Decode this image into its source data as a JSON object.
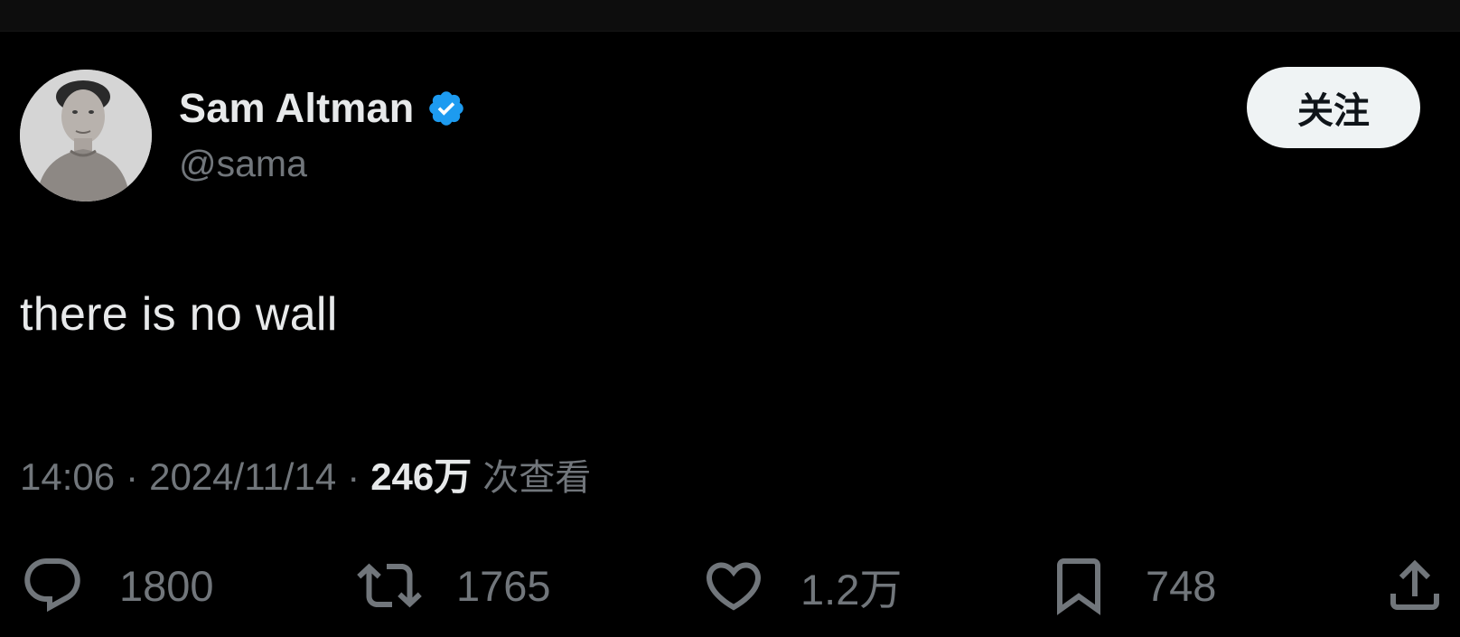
{
  "author": {
    "display_name": "Sam Altman",
    "handle": "@sama",
    "verified": true,
    "verified_color": "#1d9bf0"
  },
  "follow_button": {
    "label": "关注"
  },
  "tweet": {
    "text": "there is no wall"
  },
  "meta": {
    "time": "14:06",
    "separator": "·",
    "date": "2024/11/14",
    "views_count": "246万",
    "views_label": "次查看"
  },
  "actions": {
    "reply": {
      "icon": "reply-icon",
      "count": "1800"
    },
    "retweet": {
      "icon": "retweet-icon",
      "count": "1765"
    },
    "like": {
      "icon": "heart-icon",
      "count": "1.2万"
    },
    "bookmark": {
      "icon": "bookmark-icon",
      "count": "748"
    },
    "share": {
      "icon": "share-icon"
    }
  },
  "colors": {
    "background": "#000000",
    "primary_text": "#e7e9ea",
    "secondary_text": "#71767b",
    "button_bg": "#eff3f4"
  }
}
